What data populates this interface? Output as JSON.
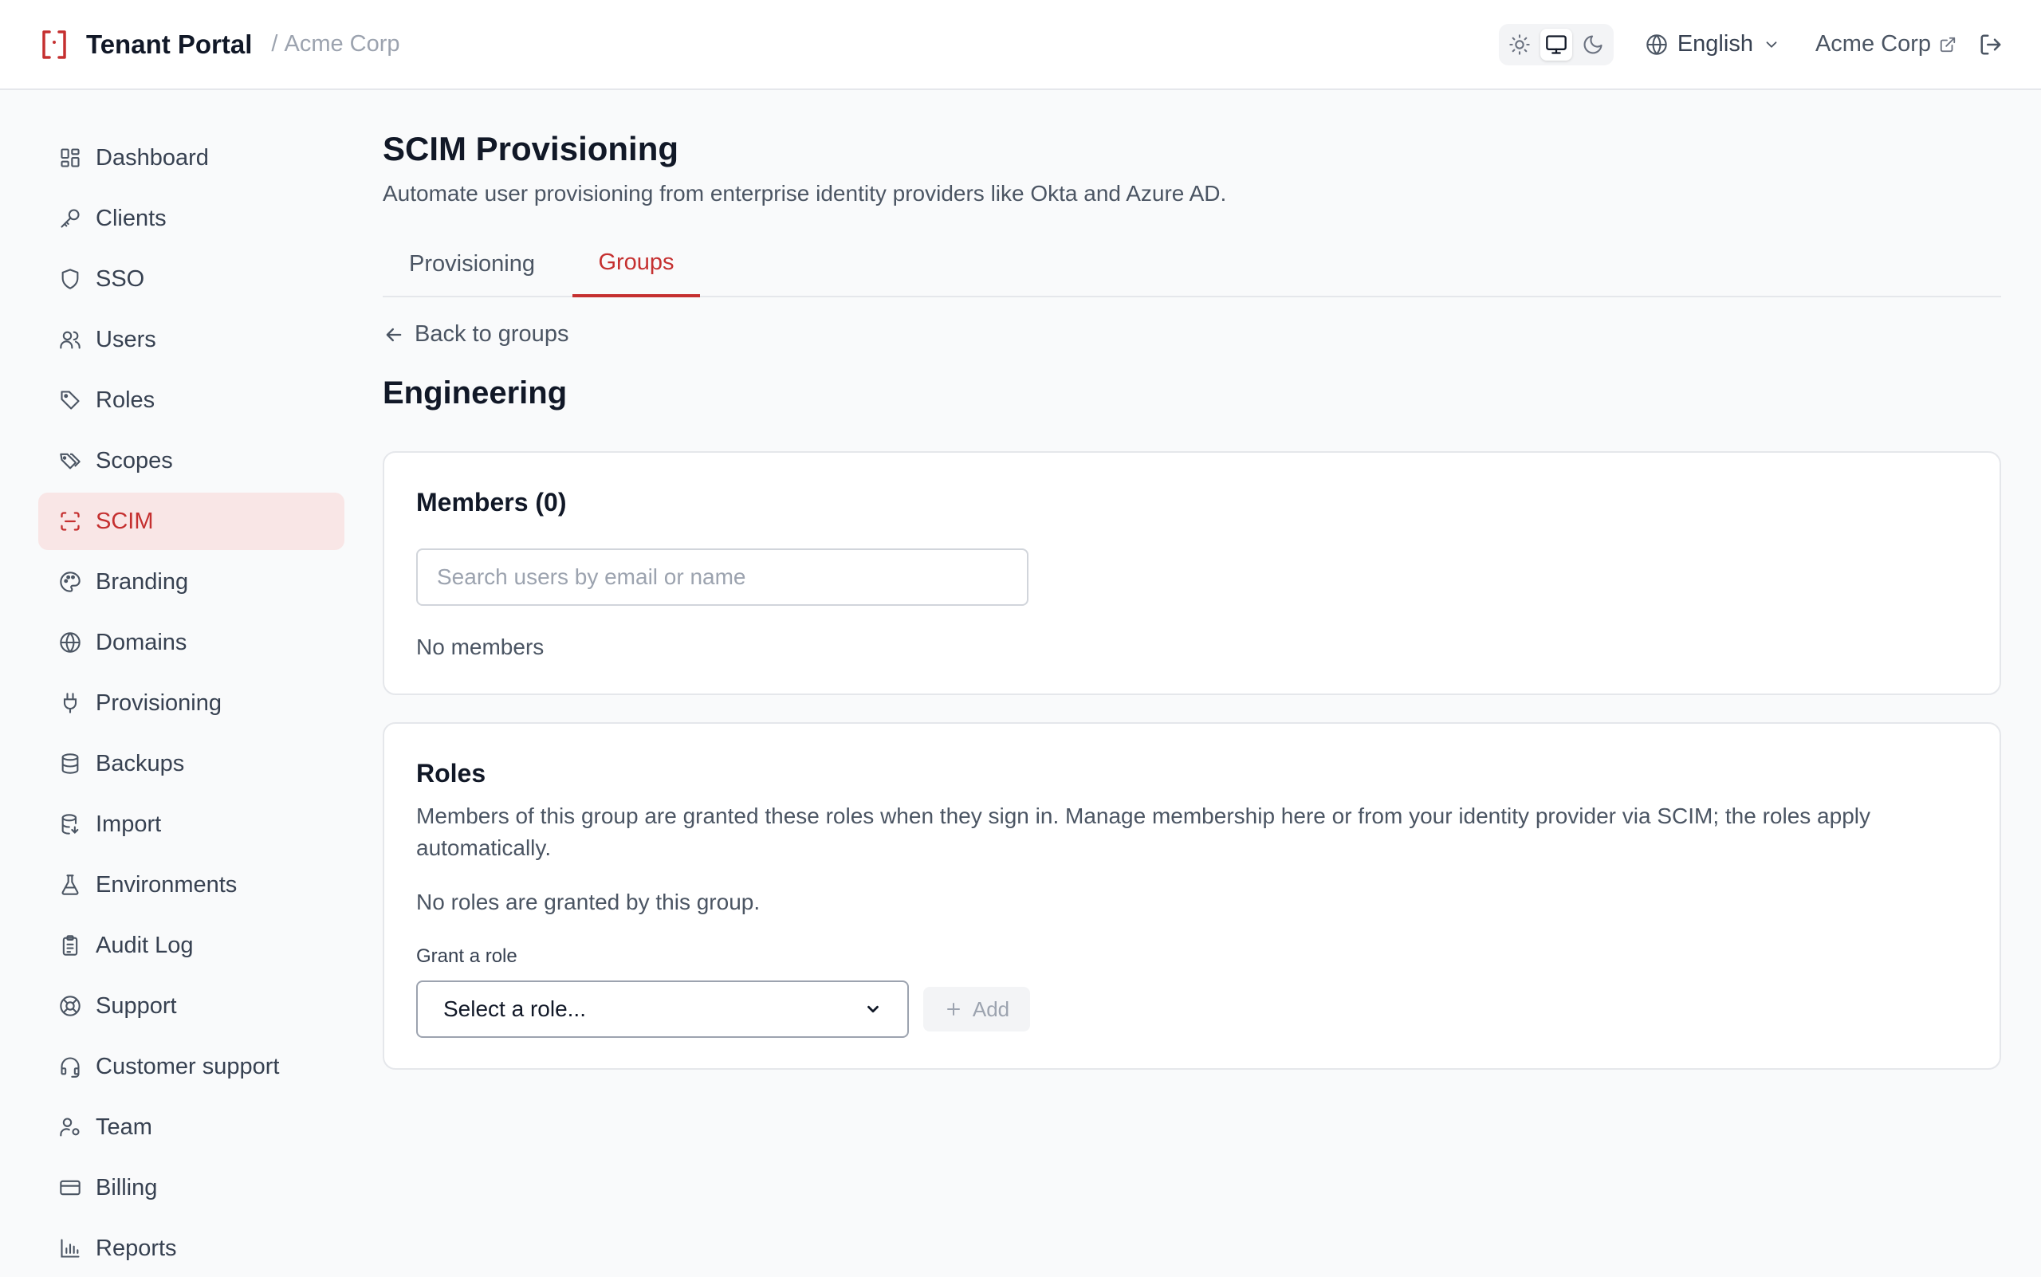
{
  "header": {
    "brand": "Tenant Portal",
    "breadcrumb_sep": "/",
    "breadcrumb": "Acme Corp",
    "language": "English",
    "tenant_link": "Acme Corp",
    "theme_options": [
      "light",
      "system",
      "dark"
    ],
    "theme_active": "system"
  },
  "colors": {
    "accent": "#c53030",
    "active_nav_bg": "#f9e6e6",
    "text": "#111827",
    "muted": "#4b5563"
  },
  "sidebar": {
    "items": [
      {
        "label": "Dashboard",
        "icon": "dashboard-icon"
      },
      {
        "label": "Clients",
        "icon": "key-icon"
      },
      {
        "label": "SSO",
        "icon": "shield-icon"
      },
      {
        "label": "Users",
        "icon": "users-icon"
      },
      {
        "label": "Roles",
        "icon": "tag-icon"
      },
      {
        "label": "Scopes",
        "icon": "tags-icon"
      },
      {
        "label": "SCIM",
        "icon": "scan-icon",
        "active": true
      },
      {
        "label": "Branding",
        "icon": "palette-icon"
      },
      {
        "label": "Domains",
        "icon": "globe-icon"
      },
      {
        "label": "Provisioning",
        "icon": "plug-icon"
      },
      {
        "label": "Backups",
        "icon": "database-icon"
      },
      {
        "label": "Import",
        "icon": "database-import-icon"
      },
      {
        "label": "Environments",
        "icon": "flask-icon"
      },
      {
        "label": "Audit Log",
        "icon": "clipboard-icon"
      },
      {
        "label": "Support",
        "icon": "lifebuoy-icon"
      },
      {
        "label": "Customer support",
        "icon": "headset-icon"
      },
      {
        "label": "Team",
        "icon": "user-cog-icon"
      },
      {
        "label": "Billing",
        "icon": "credit-card-icon"
      },
      {
        "label": "Reports",
        "icon": "bar-chart-icon"
      }
    ]
  },
  "page": {
    "title": "SCIM Provisioning",
    "subtitle": "Automate user provisioning from enterprise identity providers like Okta and Azure AD.",
    "tabs": [
      {
        "label": "Provisioning",
        "active": false
      },
      {
        "label": "Groups",
        "active": true
      }
    ],
    "back_label": "Back to groups",
    "group_name": "Engineering"
  },
  "members": {
    "title": "Members (0)",
    "search_placeholder": "Search users by email or name",
    "empty": "No members"
  },
  "roles": {
    "title": "Roles",
    "description": "Members of this group are granted these roles when they sign in. Manage membership here or from your identity provider via SCIM; the roles apply automatically.",
    "empty": "No roles are granted by this group.",
    "grant_label": "Grant a role",
    "select_value": "Select a role...",
    "add_label": "Add"
  }
}
